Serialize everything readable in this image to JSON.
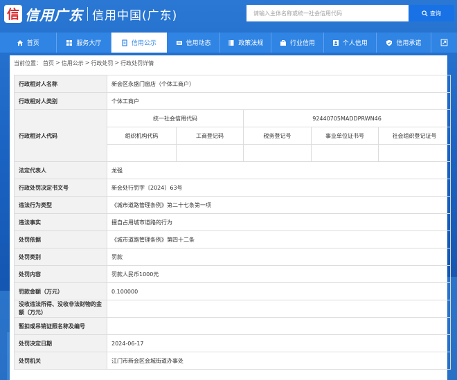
{
  "header": {
    "logo_mark": "信",
    "logo_script": "信用广东",
    "site_title": "信用中国(广东)",
    "search_placeholder": "请输入主体名称或统一社会信用代码",
    "search_button": "查询"
  },
  "nav": {
    "items": [
      {
        "label": "首页",
        "icon": "home-icon",
        "active": false
      },
      {
        "label": "服务大厅",
        "icon": "grid-icon",
        "active": false
      },
      {
        "label": "信用公示",
        "icon": "document-icon",
        "active": true
      },
      {
        "label": "信用动态",
        "icon": "news-icon",
        "active": false
      },
      {
        "label": "政策法规",
        "icon": "book-icon",
        "active": false
      },
      {
        "label": "行业信用",
        "icon": "briefcase-icon",
        "active": false
      },
      {
        "label": "个人信用",
        "icon": "person-icon",
        "active": false
      },
      {
        "label": "信用承诺",
        "icon": "shield-icon",
        "active": false
      }
    ],
    "expand_icon": "expand-icon"
  },
  "breadcrumb": {
    "prefix": "当前位置：",
    "items": [
      "首页",
      "信用公示",
      "行政处罚",
      "行政处罚详情"
    ],
    "separator": ">"
  },
  "detail": {
    "name_label": "行政相对人名称",
    "name_value": "新会区永盛门窗店（个体工商户）",
    "type_label": "行政相对人类别",
    "type_value": "个体工商户",
    "code_label": "行政相对人代码",
    "uscc_label": "统一社会信用代码",
    "uscc_value": "92440705MADDPRWN46",
    "code_headers": [
      "组织机构代码",
      "工商登记码",
      "税务登记号",
      "事业单位证书号",
      "社会组织登记证号"
    ],
    "code_values": [
      "",
      "",
      "",
      "",
      ""
    ],
    "legal_rep_label": "法定代表人",
    "legal_rep_value": "龙强",
    "decision_no_label": "行政处罚决定书文号",
    "decision_no_value": "新会处行罚字〔2024〕63号",
    "violation_type_label": "违法行为类型",
    "violation_type_value": "《城市道路管理条例》第二十七条第一项",
    "facts_label": "违法事实",
    "facts_value": "擅自占用城市道路的行为",
    "basis_label": "处罚依据",
    "basis_value": "《城市道路管理条例》第四十二条",
    "category_label": "处罚类别",
    "category_value": "罚款",
    "content_label": "处罚内容",
    "content_value": "罚款人民币1000元",
    "amount_label": "罚款金额（万元）",
    "amount_value": "0.100000",
    "confiscated_label": "没收违法所得、没收非法财物的金额（万元）",
    "confiscated_value": "",
    "license_label": "暂扣或吊销证照名称及编号",
    "license_value": "",
    "date_label": "处罚决定日期",
    "date_value": "2024-06-17",
    "authority_label": "处罚机关",
    "authority_value": "江门市新会区会城街道办事处"
  },
  "colors": {
    "brand_blue": "#2f84e4",
    "search_button": "#1872e6",
    "label_bg": "#f2f2f2"
  }
}
